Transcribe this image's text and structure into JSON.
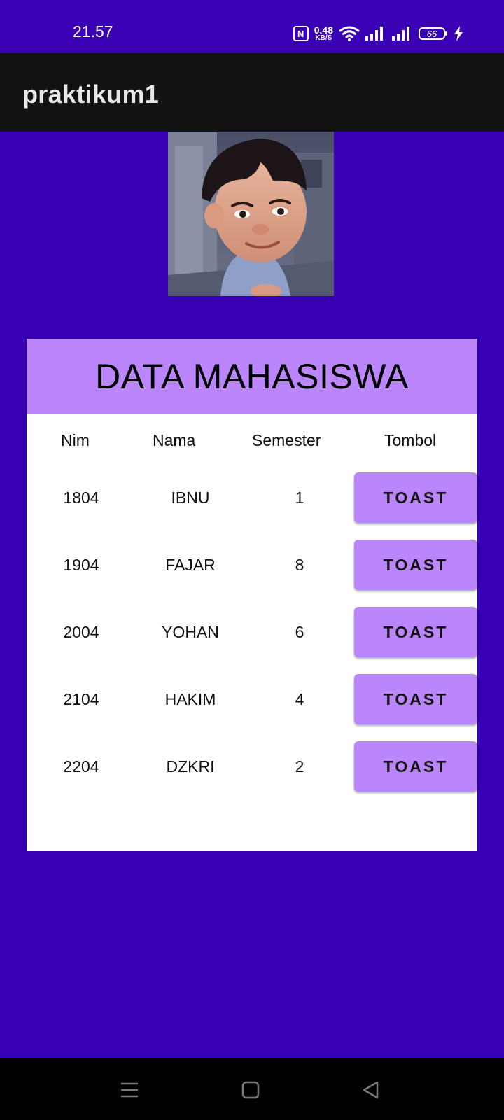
{
  "status": {
    "time": "21.57",
    "nfc": "N",
    "net_speed_value": "0.48",
    "net_speed_unit": "KB/S",
    "battery_level": "66"
  },
  "app_bar": {
    "title": "praktikum1"
  },
  "card": {
    "title": "DATA MAHASISWA",
    "headers": {
      "nim": "Nim",
      "nama": "Nama",
      "semester": "Semester",
      "tombol": "Tombol"
    },
    "rows": [
      {
        "nim": "1804",
        "nama": "IBNU",
        "semester": "1",
        "button": "TOAST"
      },
      {
        "nim": "1904",
        "nama": "FAJAR",
        "semester": "8",
        "button": "TOAST"
      },
      {
        "nim": "2004",
        "nama": "YOHAN",
        "semester": "6",
        "button": "TOAST"
      },
      {
        "nim": "2104",
        "nama": "HAKIM",
        "semester": "4",
        "button": "TOAST"
      },
      {
        "nim": "2204",
        "nama": "DZKRI",
        "semester": "2",
        "button": "TOAST"
      }
    ]
  },
  "colors": {
    "background": "#3700B3",
    "app_bar": "#121212",
    "accent": "#BB86FC",
    "card": "#FFFFFF"
  },
  "icons": {
    "status": [
      "nfc-icon",
      "wifi-icon",
      "signal-icon",
      "signal-icon",
      "battery-icon",
      "charging-icon"
    ],
    "nav": [
      "menu-icon",
      "home-icon",
      "back-icon"
    ]
  }
}
